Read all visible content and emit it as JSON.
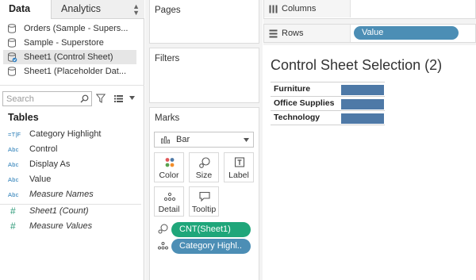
{
  "data_pane": {
    "tabs": [
      {
        "label": "Data",
        "active": true
      },
      {
        "label": "Analytics",
        "active": false
      }
    ],
    "data_sources": [
      {
        "label": "Orders (Sample - Supers...",
        "icon": "database-icon",
        "selected": false
      },
      {
        "label": "Sample - Superstore",
        "icon": "database-icon",
        "selected": false
      },
      {
        "label": "Sheet1 (Control Sheet)",
        "icon": "database-check-icon",
        "selected": true
      },
      {
        "label": "Sheet1 (Placeholder Dat...",
        "icon": "database-icon",
        "selected": false
      }
    ],
    "search": {
      "placeholder": "Search"
    },
    "tables_heading": "Tables",
    "dimensions": [
      {
        "type": "=T|F",
        "label": "Category Highlight",
        "italic": false
      },
      {
        "type": "Abc",
        "label": "Control",
        "italic": false
      },
      {
        "type": "Abc",
        "label": "Display As",
        "italic": false
      },
      {
        "type": "Abc",
        "label": "Value",
        "italic": false
      },
      {
        "type": "Abc",
        "label": "Measure Names",
        "italic": true
      }
    ],
    "measures": [
      {
        "type": "#",
        "label": "Sheet1 (Count)",
        "italic": true
      },
      {
        "type": "#",
        "label": "Measure Values",
        "italic": true
      }
    ]
  },
  "cards": {
    "pages_title": "Pages",
    "filters_title": "Filters",
    "marks": {
      "title": "Marks",
      "mark_type": "Bar",
      "buttons": {
        "color": "Color",
        "size": "Size",
        "label": "Label",
        "detail": "Detail",
        "tooltip": "Tooltip"
      },
      "pills": [
        {
          "label": "CNT(Sheet1)",
          "icon": "size-icon",
          "color": "#1fa67a"
        },
        {
          "label": "Category Highl..",
          "icon": "detail-icon",
          "color": "#4c8eb5"
        }
      ]
    }
  },
  "shelves": {
    "columns_label": "Columns",
    "rows_label": "Rows",
    "rows_pill": "Value"
  },
  "viz": {
    "title": "Control Sheet Selection (2)",
    "bar_color": "#4e79a7"
  },
  "chart_data": {
    "type": "bar",
    "title": "Control Sheet Selection (2)",
    "categories": [
      "Furniture",
      "Office Supplies",
      "Technology"
    ],
    "values": [
      1,
      1,
      1
    ],
    "xlabel": "",
    "ylabel": "",
    "orientation": "horizontal",
    "grid": false
  }
}
